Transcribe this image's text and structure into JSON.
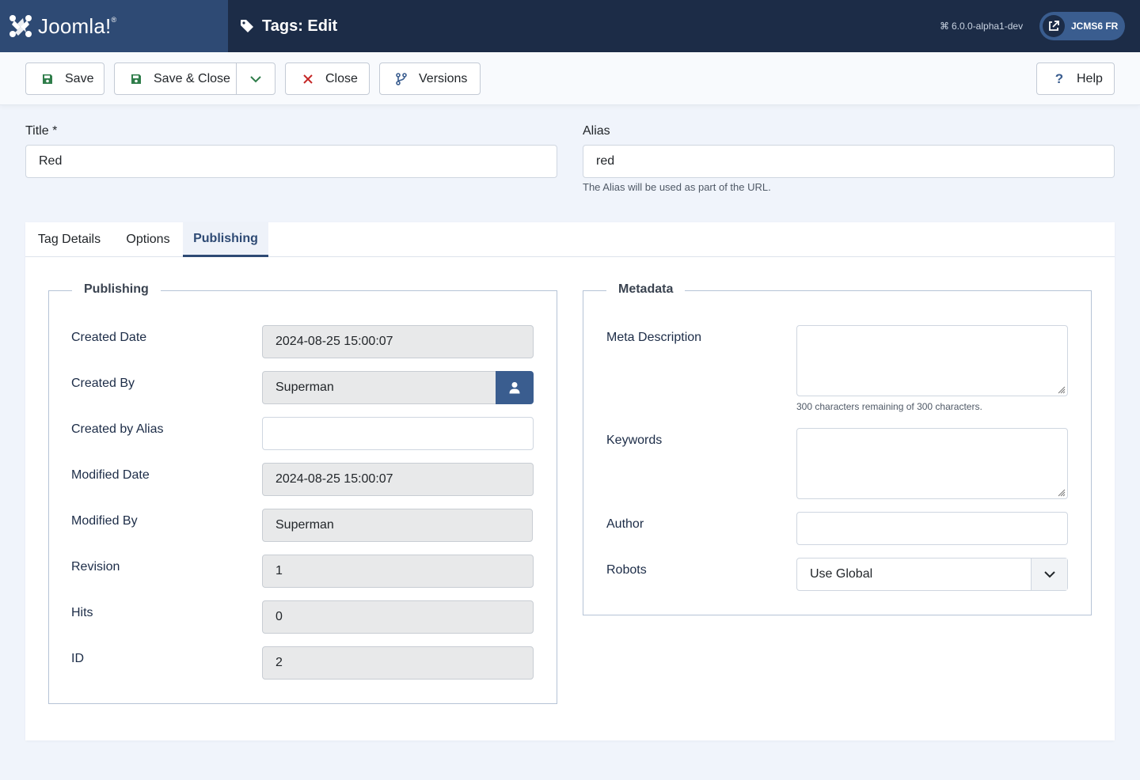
{
  "header": {
    "brand": "Joomla!",
    "brand_mark": "®",
    "page_title": "Tags: Edit",
    "version_icon": "⌘",
    "version": "6.0.0-alpha1-dev",
    "site_button": "JCMS6 FR"
  },
  "toolbar": {
    "save": "Save",
    "save_close": "Save & Close",
    "close": "Close",
    "versions": "Versions",
    "help": "Help"
  },
  "form": {
    "title_label": "Title *",
    "title_value": "Red",
    "alias_label": "Alias",
    "alias_value": "red",
    "alias_hint": "The Alias will be used as part of the URL."
  },
  "tabs": [
    {
      "label": "Tag Details"
    },
    {
      "label": "Options"
    },
    {
      "label": "Publishing"
    }
  ],
  "publishing": {
    "legend": "Publishing",
    "created_date_label": "Created Date",
    "created_date": "2024-08-25 15:00:07",
    "created_by_label": "Created By",
    "created_by": "Superman",
    "created_by_alias_label": "Created by Alias",
    "created_by_alias": "",
    "modified_date_label": "Modified Date",
    "modified_date": "2024-08-25 15:00:07",
    "modified_by_label": "Modified By",
    "modified_by": "Superman",
    "revision_label": "Revision",
    "revision": "1",
    "hits_label": "Hits",
    "hits": "0",
    "id_label": "ID",
    "id": "2"
  },
  "metadata": {
    "legend": "Metadata",
    "meta_description_label": "Meta Description",
    "meta_description_hint": "300 characters remaining of 300 characters.",
    "keywords_label": "Keywords",
    "author_label": "Author",
    "robots_label": "Robots",
    "robots_value": "Use Global"
  },
  "colors": {
    "header_bg": "#1c2c47",
    "brand_bg": "#2e4a74",
    "accent": "#3a5d8f",
    "save_icon": "#2f7d4a",
    "close_icon": "#c52827"
  }
}
